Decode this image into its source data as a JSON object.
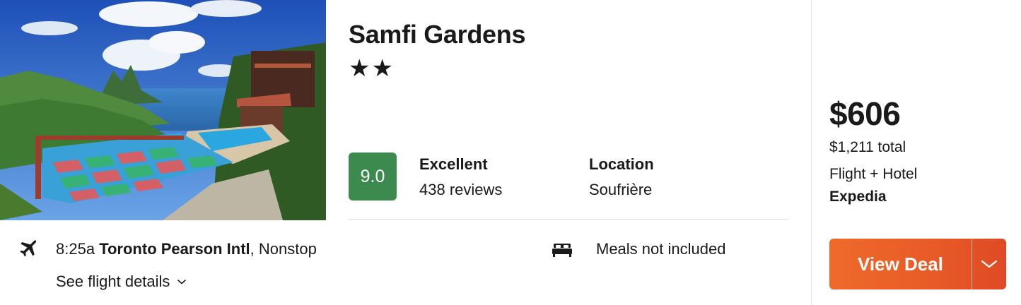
{
  "hotel": {
    "name": "Samfi Gardens",
    "stars_display": "★★",
    "star_count": 2
  },
  "rating": {
    "score": "9.0",
    "label": "Excellent",
    "reviews": "438 reviews",
    "score_color": "#3c8a4e"
  },
  "location": {
    "label": "Location",
    "value": "Soufrière"
  },
  "flight": {
    "time": "8:25a",
    "airport": "Toronto Pearson Intl",
    "stops": ", Nonstop",
    "details_link": "See flight details",
    "icon": "plane-icon"
  },
  "meals": {
    "text": "Meals not included",
    "icon": "bed-icon"
  },
  "pricing": {
    "price": "$606",
    "total": "$1,211 total",
    "package": "Flight + Hotel",
    "provider": "Expedia"
  },
  "cta": {
    "label": "View Deal",
    "color": "#e85a27"
  }
}
